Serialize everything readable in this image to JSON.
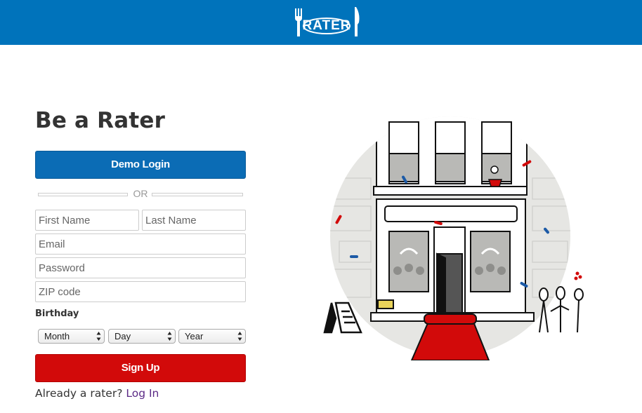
{
  "header": {
    "logo_text": "RATER",
    "brand_color": "#0073bb"
  },
  "form": {
    "title": "Be a Rater",
    "demo_login_label": "Demo Login",
    "divider_text": "OR",
    "first_name_placeholder": "First Name",
    "last_name_placeholder": "Last Name",
    "email_placeholder": "Email",
    "password_placeholder": "Password",
    "zip_placeholder": "ZIP code",
    "birthday_label": "Birthday",
    "month_value": "Month",
    "day_value": "Day",
    "year_value": "Year",
    "signup_label": "Sign Up",
    "already_text": "Already a rater?",
    "login_link": "Log In",
    "accent_blue": "#0b6cb5",
    "accent_red": "#d20a0a"
  },
  "illustration": {
    "icon": "restaurant-storefront-illustration"
  }
}
